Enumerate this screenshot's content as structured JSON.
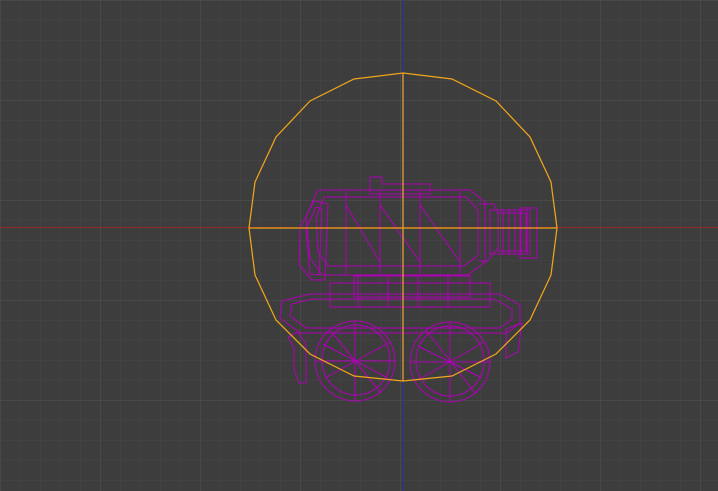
{
  "viewport": {
    "background": "#3d3d3d",
    "grid_minor_color": "#474747",
    "grid_major_color": "#535353",
    "axis_x_color": "#8f2b2b",
    "axis_y_color": "#2831a9"
  },
  "objects": [
    {
      "name": "sphere-selection",
      "color": "#f0a51a",
      "selected": true
    },
    {
      "name": "vehicle-model",
      "color": "#b100b8",
      "wireframe": true
    }
  ]
}
